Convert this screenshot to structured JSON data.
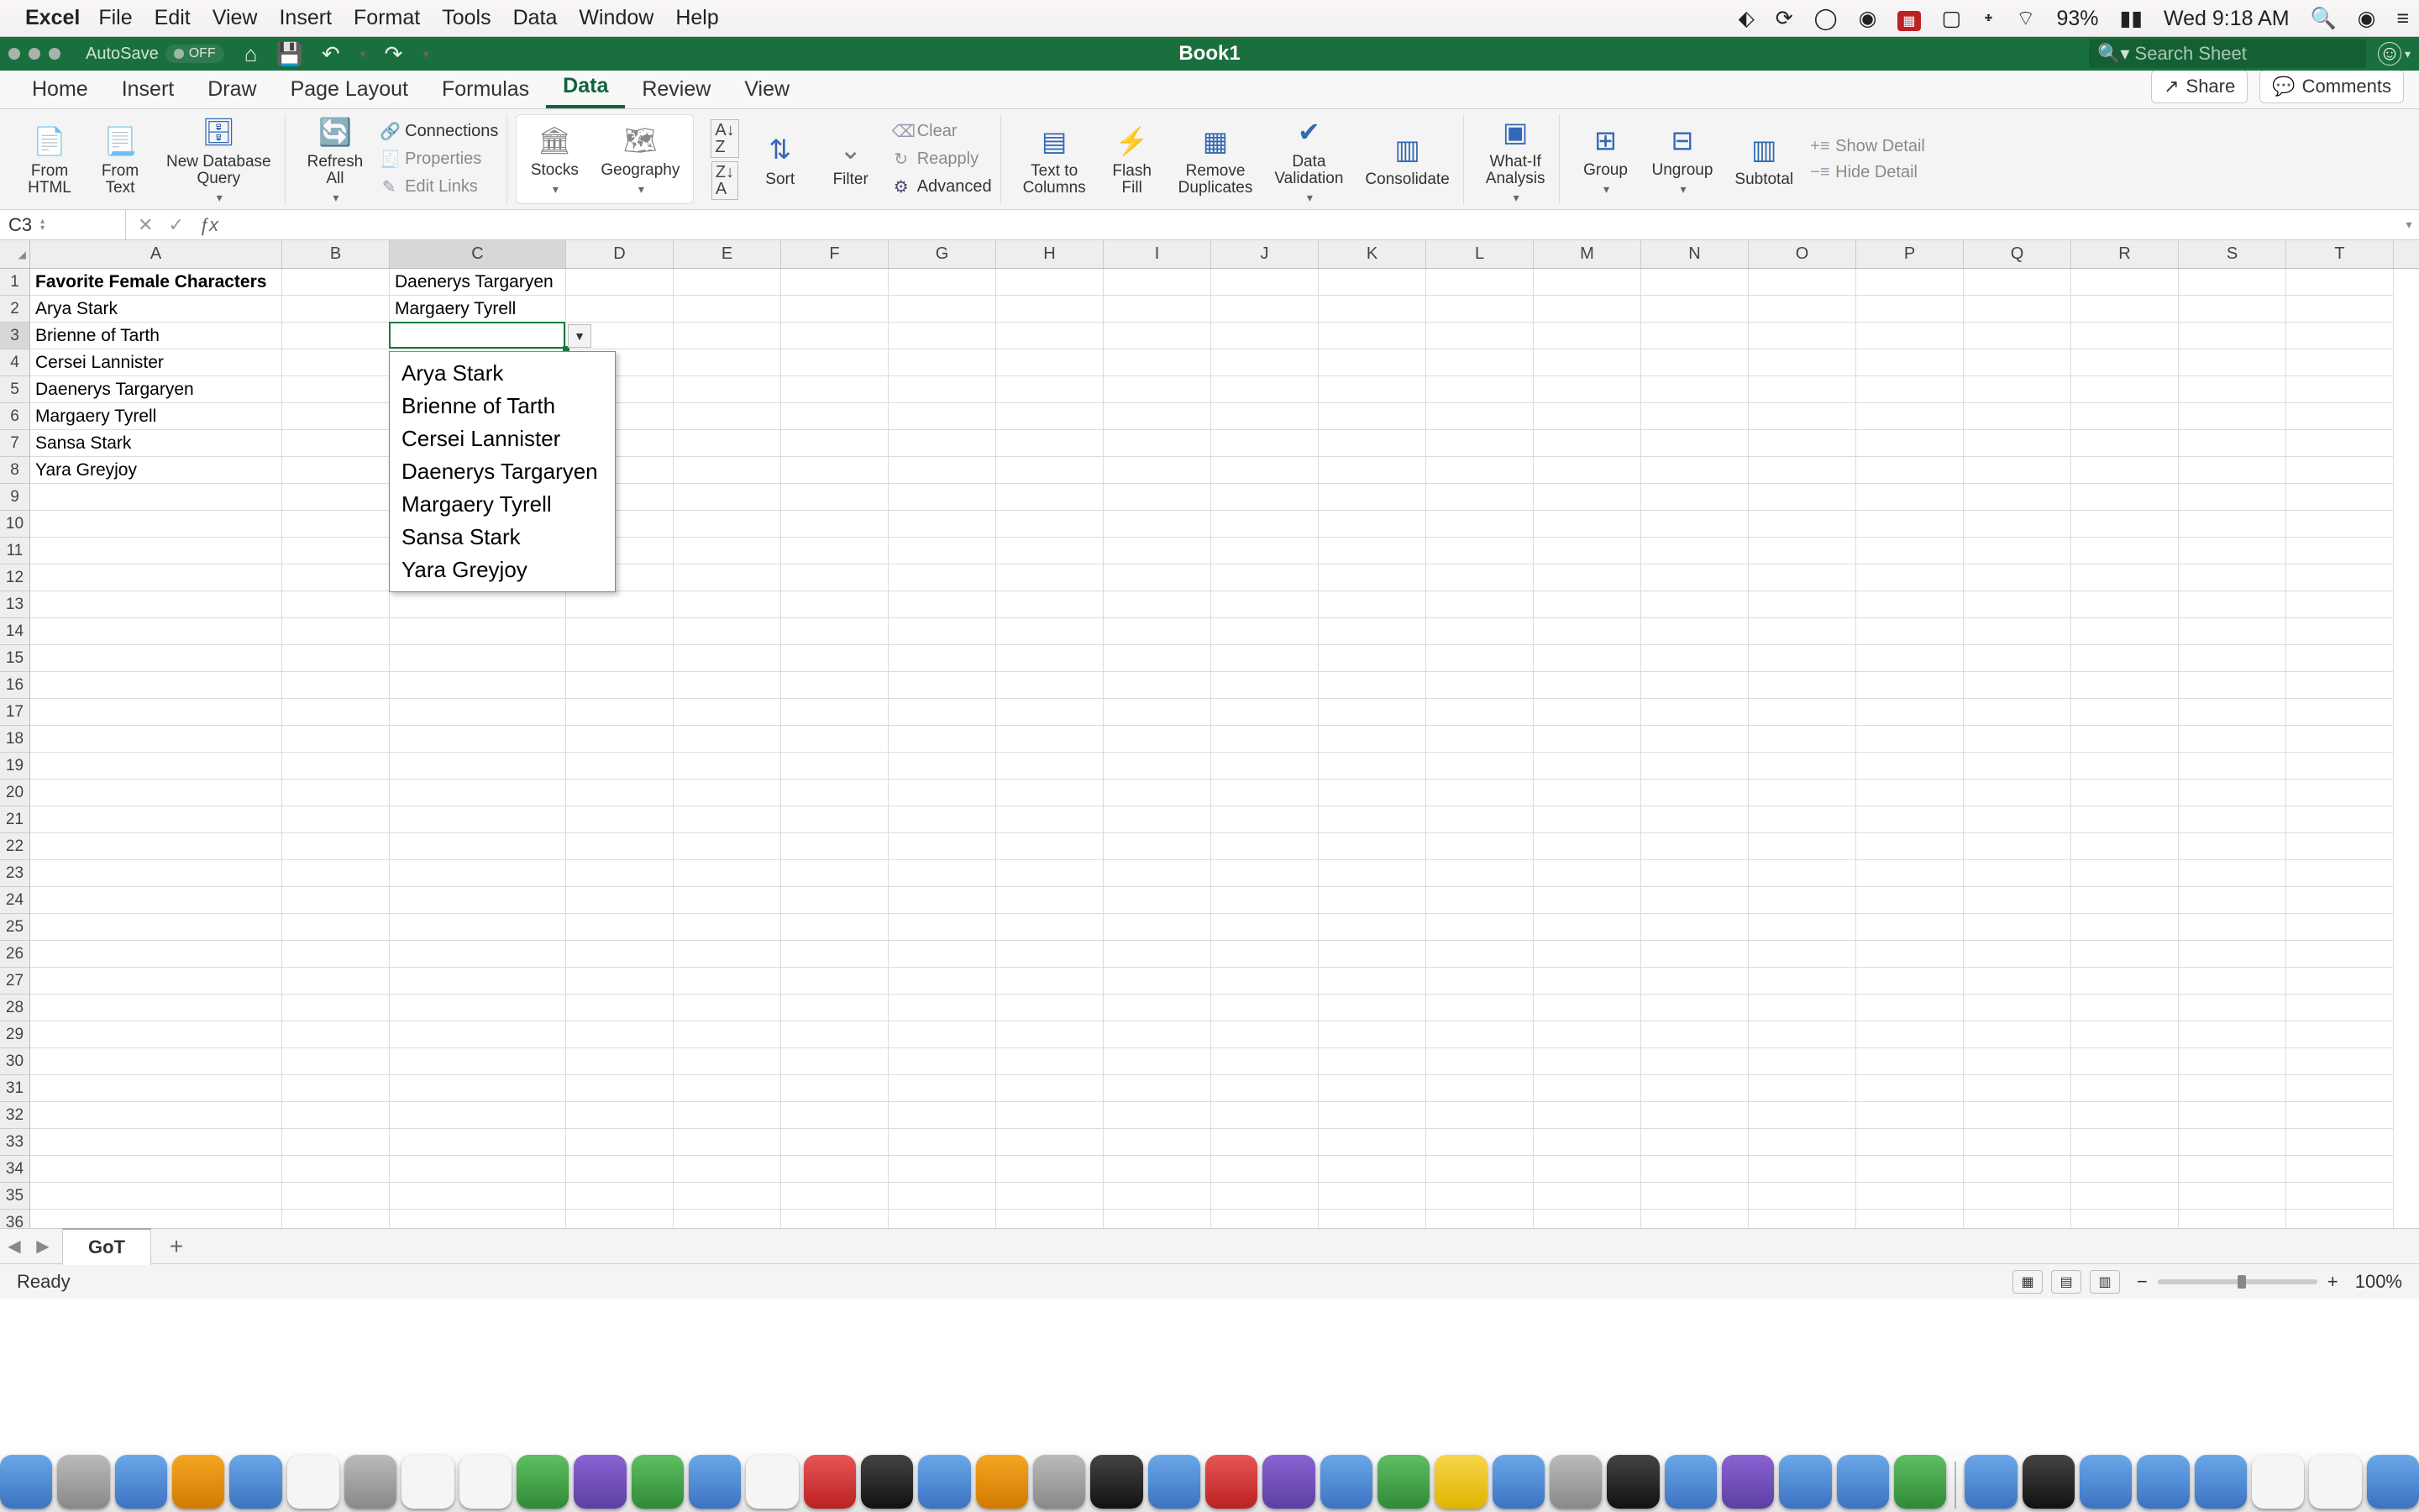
{
  "mac_menu": {
    "app": "Excel",
    "items": [
      "File",
      "Edit",
      "View",
      "Insert",
      "Format",
      "Tools",
      "Data",
      "Window",
      "Help"
    ],
    "battery_pct": "93%",
    "clock": "Wed 9:18 AM"
  },
  "titlebar": {
    "autosave_label": "AutoSave",
    "autosave_state": "OFF",
    "doc_title": "Book1",
    "search_placeholder": "Search Sheet"
  },
  "ribbon_tabs": {
    "tabs": [
      "Home",
      "Insert",
      "Draw",
      "Page Layout",
      "Formulas",
      "Data",
      "Review",
      "View"
    ],
    "active": "Data",
    "share_label": "Share",
    "comments_label": "Comments"
  },
  "ribbon": {
    "from_html": "From\nHTML",
    "from_text": "From\nText",
    "new_db_query": "New Database\nQuery",
    "refresh_all": "Refresh\nAll",
    "connections": "Connections",
    "properties": "Properties",
    "edit_links": "Edit Links",
    "stocks": "Stocks",
    "geography": "Geography",
    "sort": "Sort",
    "filter": "Filter",
    "clear": "Clear",
    "reapply": "Reapply",
    "advanced": "Advanced",
    "text_to_columns": "Text to\nColumns",
    "flash_fill": "Flash\nFill",
    "remove_duplicates": "Remove\nDuplicates",
    "data_validation": "Data\nValidation",
    "consolidate": "Consolidate",
    "whatif": "What-If\nAnalysis",
    "group": "Group",
    "ungroup": "Ungroup",
    "subtotal": "Subtotal",
    "show_detail": "Show Detail",
    "hide_detail": "Hide Detail"
  },
  "formula_bar": {
    "name_box": "C3",
    "formula": ""
  },
  "grid": {
    "columns": [
      "A",
      "B",
      "C",
      "D",
      "E",
      "F",
      "G",
      "H",
      "I",
      "J",
      "K",
      "L",
      "M",
      "N",
      "O",
      "P",
      "Q",
      "R",
      "S",
      "T"
    ],
    "col_widths": {
      "A": 300,
      "default": 128,
      "C": 210
    },
    "row_count": 37,
    "active_cell": {
      "col": "C",
      "row": 3
    },
    "cells": {
      "A1": {
        "v": "Favorite Female Characters",
        "bold": true
      },
      "A2": {
        "v": "Arya Stark"
      },
      "A3": {
        "v": "Brienne of Tarth"
      },
      "A4": {
        "v": "Cersei Lannister"
      },
      "A5": {
        "v": "Daenerys Targaryen"
      },
      "A6": {
        "v": "Margaery Tyrell"
      },
      "A7": {
        "v": "Sansa Stark"
      },
      "A8": {
        "v": "Yara Greyjoy"
      },
      "C1": {
        "v": "Daenerys Targaryen"
      },
      "C2": {
        "v": "Margaery Tyrell"
      }
    },
    "dropdown": {
      "items": [
        "Arya Stark",
        "Brienne of Tarth",
        "Cersei Lannister",
        "Daenerys Targaryen",
        "Margaery Tyrell",
        "Sansa Stark",
        "Yara Greyjoy"
      ]
    }
  },
  "sheet_tabs": {
    "active": "GoT"
  },
  "statusbar": {
    "left": "Ready",
    "zoom": "100%"
  },
  "dock_apps": [
    "finder",
    "siri",
    "safari",
    "clock",
    "mail",
    "photos",
    "contacts",
    "reminders",
    "calendar",
    "messages",
    "maps",
    "facetime",
    "podcasts",
    "notes",
    "music",
    "stocks",
    "appstore",
    "books",
    "settings",
    "terminal",
    "chrome",
    "powerpoint",
    "slack",
    "vscode",
    "xcode",
    "onenote",
    "teams",
    "preview",
    "calculator",
    "folder",
    "viber",
    "slack2",
    "word",
    "excel",
    "finder2",
    "bridge",
    "folder2",
    "folder3",
    "folder4",
    "notes2",
    "textedit",
    "chrome2"
  ]
}
